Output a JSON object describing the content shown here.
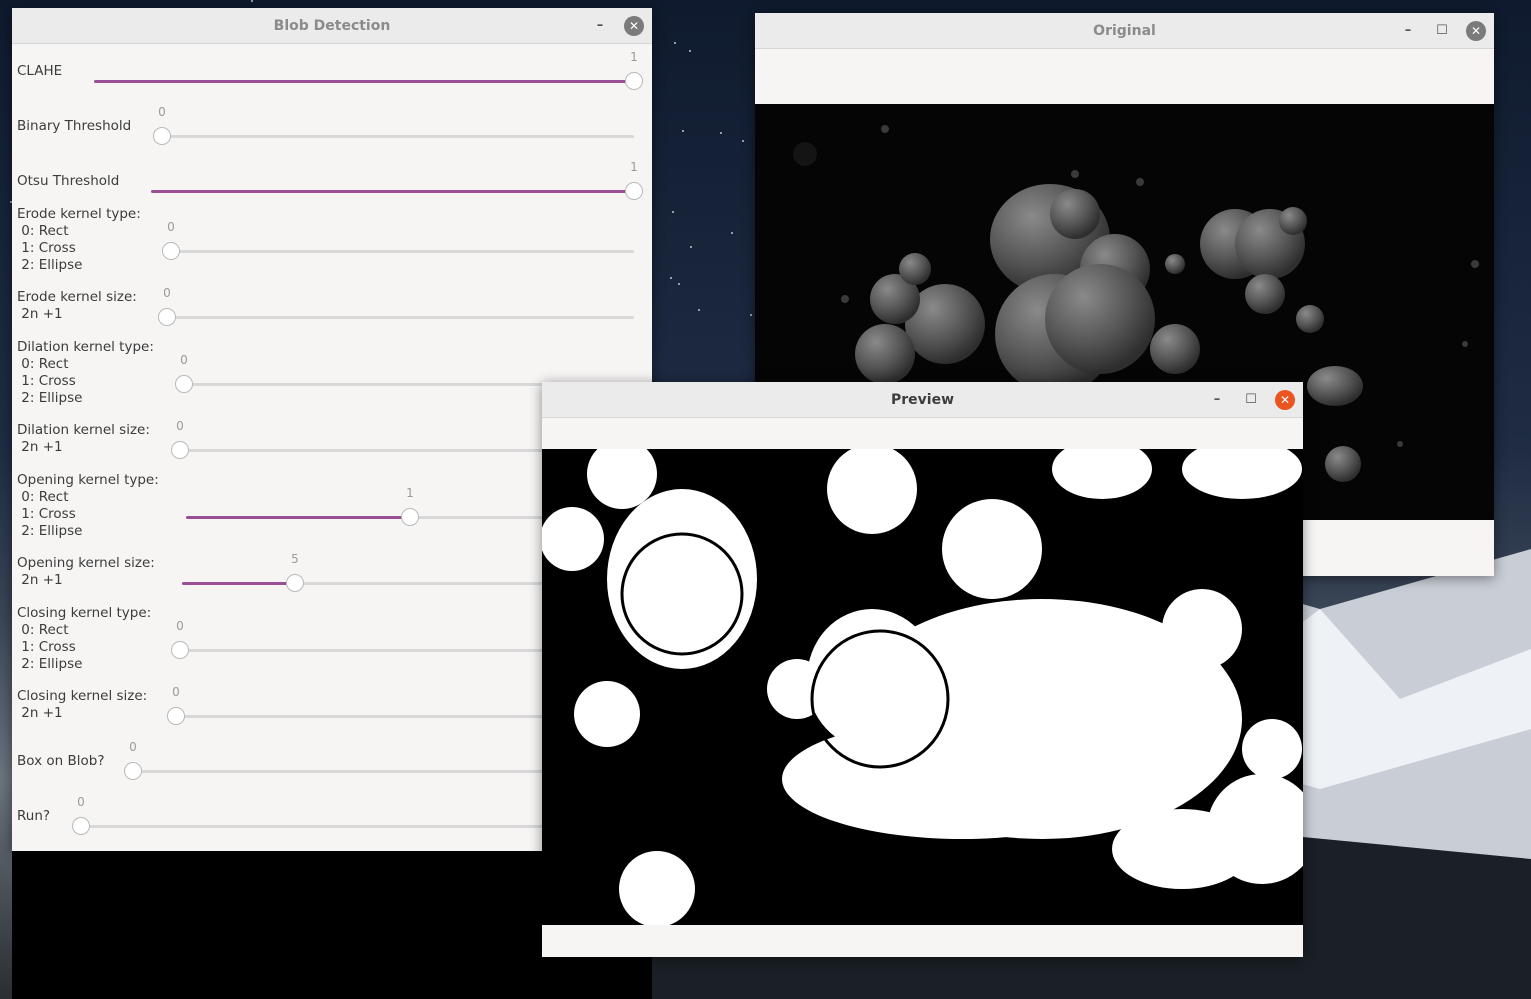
{
  "blob_window": {
    "title": "Blob Detection",
    "trackbars": [
      {
        "label": "CLAHE",
        "value": "1",
        "max_fraction": 1.0
      },
      {
        "label": "Binary Threshold",
        "value": "0",
        "max_fraction": 0.0
      },
      {
        "label": "Otsu Threshold",
        "value": "1",
        "max_fraction": 1.0
      },
      {
        "label": "Erode kernel type:\n 0: Rect\n 1: Cross\n 2: Ellipse",
        "value": "0",
        "max_fraction": 0.0
      },
      {
        "label": "Erode kernel size:\n 2n +1",
        "value": "0",
        "max_fraction": 0.0
      },
      {
        "label": "Dilation kernel type:\n 0: Rect\n 1: Cross\n 2: Ellipse",
        "value": "0",
        "max_fraction": 0.0
      },
      {
        "label": "Dilation kernel size:\n 2n +1",
        "value": "0",
        "max_fraction": 0.0
      },
      {
        "label": "Opening kernel type:\n 0: Rect\n 1: Cross\n 2: Ellipse",
        "value": "1",
        "max_fraction": 0.5
      },
      {
        "label": "Opening kernel size:\n 2n +1",
        "value": "5",
        "max_fraction": 0.25
      },
      {
        "label": "Closing kernel type:\n 0: Rect\n 1: Cross\n 2: Ellipse",
        "value": "0",
        "max_fraction": 0.0
      },
      {
        "label": "Closing kernel size:\n 2n +1",
        "value": "0",
        "max_fraction": 0.0
      },
      {
        "label": "Box on Blob?",
        "value": "0",
        "max_fraction": 0.0
      },
      {
        "label": "Run?",
        "value": "0",
        "max_fraction": 0.0
      }
    ]
  },
  "original_window": {
    "title": "Original"
  },
  "preview_window": {
    "title": "Preview"
  },
  "colors": {
    "accent": "#9a4f94",
    "close_active": "#e95420"
  }
}
